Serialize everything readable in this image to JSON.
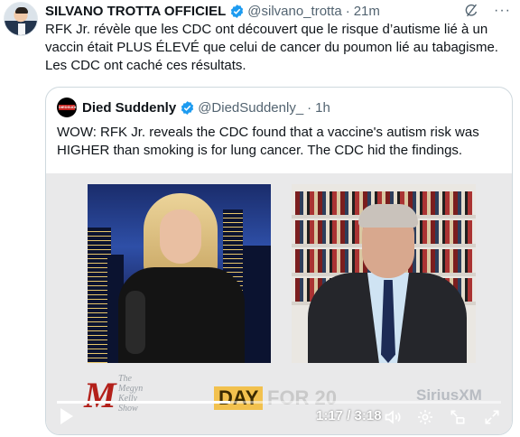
{
  "tweet": {
    "author_name": "SILVANO TROTTA OFFICIEL",
    "handle": "@silvano_trotta",
    "separator": "·",
    "time": "21m",
    "more": "···",
    "text": "RFK Jr. révèle que les CDC ont découvert que le risque d’autisme lié à un vaccin était PLUS ÉLEVÉ que celui de cancer du poumon lié au tabagisme. Les CDC ont caché ces résultats."
  },
  "quote": {
    "author_name": "Died Suddenly",
    "handle": "@DiedSuddenly_",
    "separator": "·",
    "time": "1h",
    "avatar_text": "DIEDSUDDENLY.COM",
    "text": "WOW: RFK Jr. reveals the CDC found that a vaccine's autism risk was HIGHER than smoking is for lung cancer. The CDC hid the findings."
  },
  "video": {
    "logo_letter": "M",
    "logo_text": "The Megyn Kelly Show",
    "badge_text": "DAY",
    "badge_rest": "FOR 20",
    "network": "SiriusXM",
    "current_time": "1:17",
    "duration": "3:18",
    "time_display": "1:17 / 3:18",
    "progress_fraction": 0.39
  },
  "icons": {
    "verified": "verified-badge-icon",
    "grok": "grok-icon",
    "play": "play-icon",
    "volume": "volume-icon",
    "settings": "settings-gear-icon",
    "popout": "popout-icon",
    "fullscreen": "fullscreen-icon"
  },
  "colors": {
    "verified_blue": "#1d9bf0",
    "secondary_text": "#536471",
    "border": "#cfd9de"
  }
}
